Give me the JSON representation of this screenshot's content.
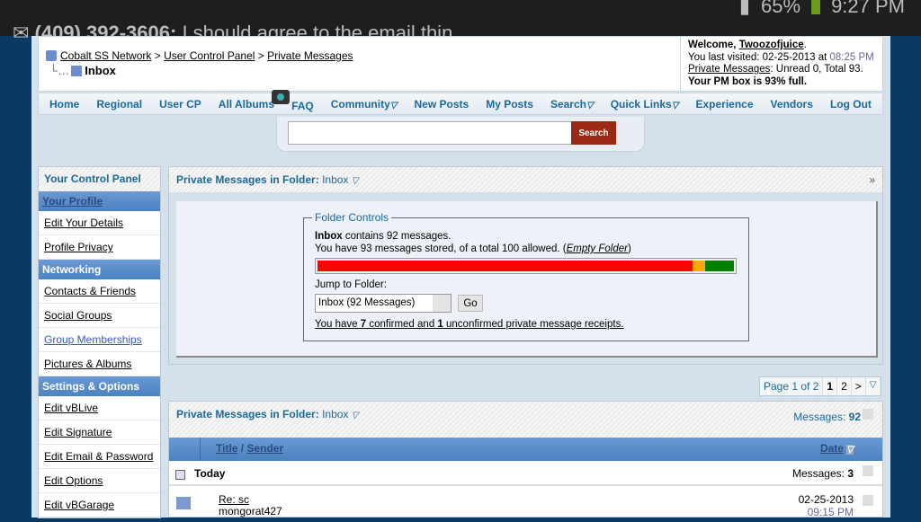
{
  "status_bar": {
    "battery": "65%",
    "time": "9:27 PM",
    "notification_sender": "(409) 392-3606:",
    "notification_text": "I should agree to the email thin"
  },
  "breadcrumb": [
    "Cobalt SS Network",
    "User Control Panel",
    "Private Messages"
  ],
  "current": "Inbox",
  "welcome": {
    "prefix": "Welcome,",
    "user": "Twoozofjuice",
    "visited_label": "You last visited: 02-25-2013 at",
    "visited_time": "08:25 PM",
    "pm_link": "Private Messages",
    "pm_counts": ": Unread 0, Total 93.",
    "full": "Your PM box is 93% full."
  },
  "nav": [
    "Home",
    "Regional",
    "User CP",
    "All Albums",
    "FAQ",
    "Community",
    "New Posts",
    "My Posts",
    "Search",
    "Quick Links",
    "Experience",
    "Vendors",
    "Log Out"
  ],
  "search": {
    "placeholder": "",
    "button": "Search"
  },
  "sidebar": {
    "title": "Your Control Panel",
    "sections": [
      {
        "label": "Your Profile",
        "items": [
          "Edit Your Details",
          "Profile Privacy"
        ]
      },
      {
        "label": "Networking",
        "items": [
          "Contacts & Friends",
          "Social Groups",
          "Group Memberships",
          "Pictures & Albums"
        ]
      },
      {
        "label": "Settings & Options",
        "items": [
          "Edit vBLive",
          "Edit Signature",
          "Edit Email & Password",
          "Edit Options",
          "Edit vBGarage"
        ]
      }
    ]
  },
  "folder_panel": {
    "title": "Private Messages in Folder:",
    "folder": "Inbox",
    "legend": "Folder Controls",
    "inbox_bold": "Inbox",
    "contains": " contains 92 messages.",
    "stored": "You have 93 messages stored, of a total 100 allowed. (",
    "empty": "Empty Folder",
    "close_paren": ")",
    "usage_percent": 93,
    "bar_colors": {
      "used": "#ff0000",
      "warn": "#ffa500",
      "free": "#008000"
    },
    "jump_label": "Jump to Folder:",
    "jump_value": "Inbox (92 Messages)",
    "go": "Go",
    "receipts": {
      "a": "You have ",
      "confirmed": "7",
      "b": " confirmed and ",
      "unconfirmed": "1",
      "c": " unconfirmed private message receipts."
    }
  },
  "pager": {
    "info": "Page 1 of 2",
    "pages": [
      "1",
      "2",
      ">"
    ]
  },
  "list_panel": {
    "title": "Private Messages in Folder:",
    "folder": "Inbox",
    "messages_label": "Messages: ",
    "messages_count": "92",
    "col_title": "Title",
    "col_sep": " / ",
    "col_sender": "Sender",
    "col_date": "Date",
    "group": "Today",
    "group_count_label": "Messages: ",
    "group_count": "3",
    "rows": [
      {
        "title": "Re: sc",
        "sender": "mongorat427",
        "date": "02-25-2013",
        "time": "09:15 PM"
      }
    ]
  }
}
